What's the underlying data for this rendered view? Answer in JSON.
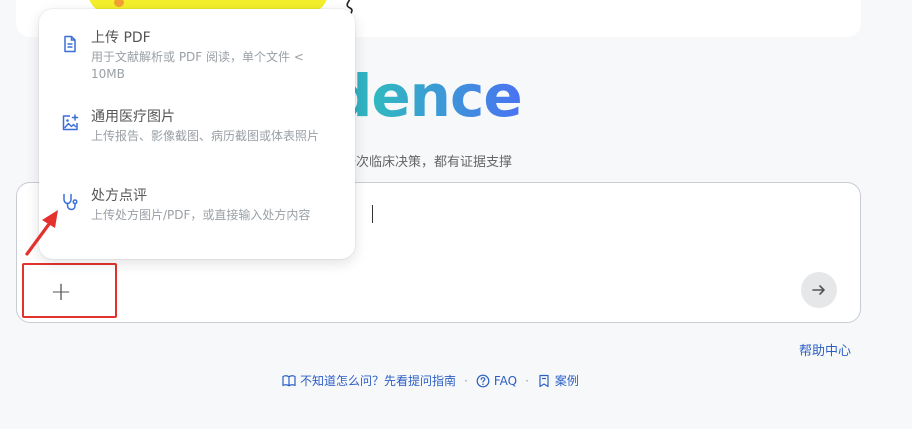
{
  "logo": {
    "text": "pEvidence"
  },
  "tagline": "每一次临床决策，都有证据支撑",
  "input": {
    "visible_text": "？"
  },
  "menu": {
    "items": [
      {
        "title": "上传 PDF",
        "description": "用于文献解析或 PDF 阅读，单个文件 < 10MB",
        "icon": "file-icon"
      },
      {
        "title": "通用医疗图片",
        "description": "上传报告、影像截图、病历截图或体表照片",
        "icon": "image-add-icon"
      },
      {
        "title": "处方点评",
        "description": "上传处方图片/PDF，或直接输入处方内容",
        "icon": "stethoscope-icon"
      }
    ]
  },
  "buttons": {
    "plus": "+",
    "send": "arrow-right-icon"
  },
  "help": {
    "label": "帮助中心"
  },
  "footer": {
    "links": [
      {
        "label": "不知道怎么问？先看提问指南",
        "icon": "book-icon"
      },
      {
        "label": "FAQ",
        "icon": "question-circle-icon"
      },
      {
        "label": "案例",
        "icon": "bookmark-icon"
      }
    ],
    "separator": "·"
  },
  "colors": {
    "accent": "#2c5fc4",
    "menu_icon": "#3a6fd8",
    "highlight_box": "#e3322d",
    "logo_gradient_start": "#3a6fe0",
    "logo_gradient_mid": "#31b8c0",
    "logo_gradient_end": "#4a72f2"
  }
}
